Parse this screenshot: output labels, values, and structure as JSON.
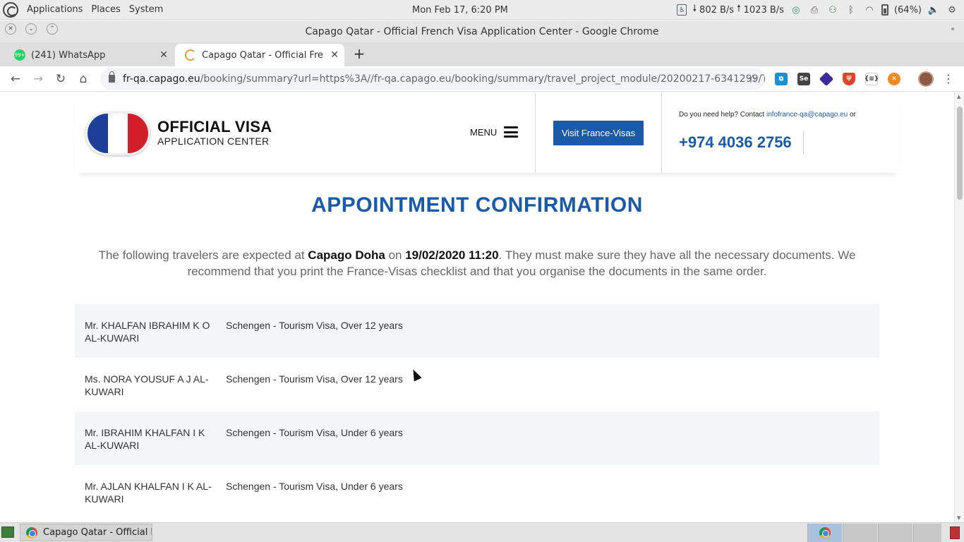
{
  "top_panel": {
    "menus": [
      "Applications",
      "Places",
      "System"
    ],
    "clock": "Mon Feb 17,  6:20 PM",
    "net_down": "802 B/s",
    "net_up": "1023 B/s",
    "battery": "(64%)"
  },
  "window": {
    "title": "Capago Qatar - Official French Visa Application Center - Google Chrome"
  },
  "tabs": [
    {
      "label": "(241) WhatsApp",
      "favicon_badge": "99+"
    },
    {
      "label": "Capago Qatar - Official French"
    }
  ],
  "toolbar": {
    "url_host": "fr-qa.capago.eu",
    "url_rest": "/booking/summary?url=https%3A//fr-qa.capago.eu/booking/summary/travel_project_module/20200217-6341299/Travel..."
  },
  "site": {
    "brand_line1": "OFFICIAL VISA",
    "brand_line2": "APPLICATION CENTER",
    "menu_label": "MENU",
    "visit_button": "Visit France-Visas",
    "help_prefix": "Do you need help? Contact ",
    "help_email": "infofrance-qa@capago.eu",
    "help_suffix": " or",
    "phone": "+974 4036 2756",
    "flag_colors": [
      "#1e3f99",
      "#ffffff",
      "#d2202a"
    ]
  },
  "page": {
    "title": "APPOINTMENT CONFIRMATION",
    "intro_1": "The following travelers are expected at ",
    "center": "Capago Doha",
    "intro_2": " on ",
    "datetime": "19/02/2020 11:20",
    "intro_3": ". They must make sure they have all the necessary documents. We recommend that you print the France-Visas checklist and that you organise the documents in the same order."
  },
  "travelers": [
    {
      "name": "Mr. KHALFAN IBRAHIM K O AL-KUWARI",
      "visa": "Schengen - Tourism Visa, Over 12 years"
    },
    {
      "name": "Ms. NORA YOUSUF A J AL-KUWARI",
      "visa": "Schengen - Tourism Visa, Over 12 years"
    },
    {
      "name": "Mr. IBRAHIM KHALFAN I K AL-KUWARI",
      "visa": "Schengen - Tourism Visa, Under 6 years"
    },
    {
      "name": "Mr. AJLAN KHALFAN I K AL-KUWARI",
      "visa": "Schengen - Tourism Visa, Under 6 years"
    }
  ],
  "taskbar": {
    "task_label": "Capago Qatar - Official F..."
  },
  "colors": {
    "brand_blue": "#1b5aa6",
    "row_stripe": "#f3f6f9"
  }
}
